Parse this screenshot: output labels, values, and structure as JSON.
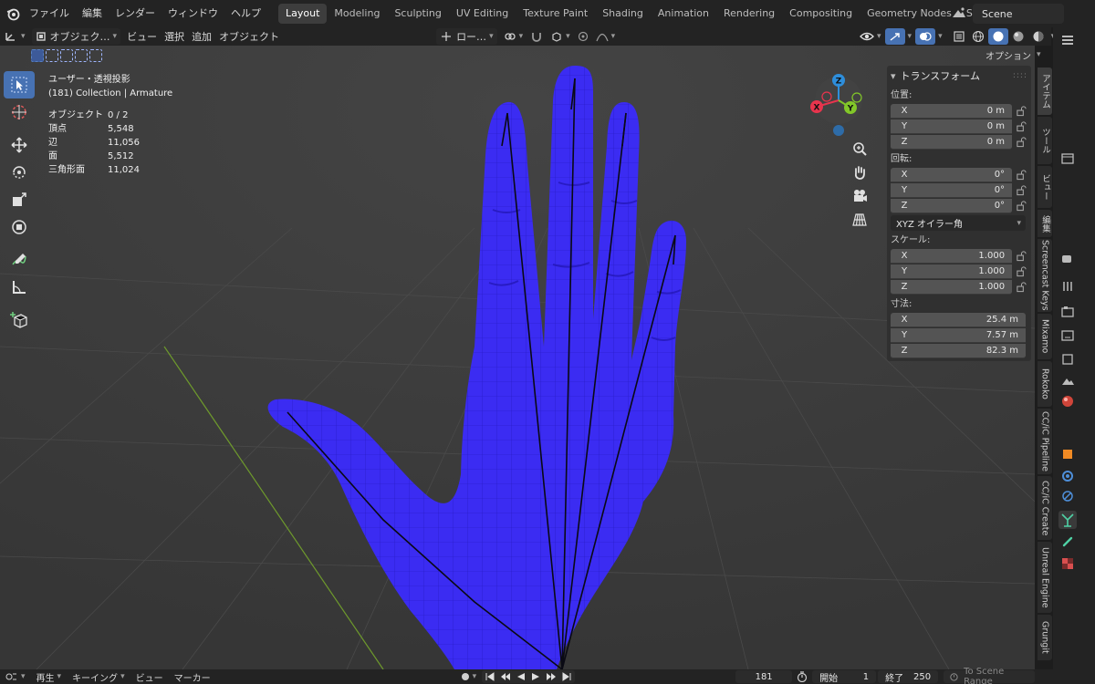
{
  "topbar": {
    "menus": [
      "ファイル",
      "編集",
      "レンダー",
      "ウィンドウ",
      "ヘルプ"
    ],
    "workspace_tabs": [
      "Layout",
      "Modeling",
      "Sculpting",
      "UV Editing",
      "Texture Paint",
      "Shading",
      "Animation",
      "Rendering",
      "Compositing",
      "Geometry Nodes",
      "Scripting"
    ],
    "active_tab": "Layout",
    "add_tab": "+",
    "scene_name": "Scene"
  },
  "viewport_header": {
    "mode": "オブジェク…",
    "menus": [
      "ビュー",
      "選択",
      "追加",
      "オブジェクト"
    ],
    "orientation": "ロー…",
    "options": "オプション"
  },
  "viewport_info": {
    "view_name": "ユーザー・透視投影",
    "collection": "(181) Collection | Armature",
    "stats": [
      {
        "label": "オブジェクト",
        "value": "0 / 2"
      },
      {
        "label": "頂点",
        "value": "5,548"
      },
      {
        "label": "辺",
        "value": "11,056"
      },
      {
        "label": "面",
        "value": "5,512"
      },
      {
        "label": "三角形面",
        "value": "11,024"
      }
    ]
  },
  "gizmo": {
    "x": "X",
    "y": "Y",
    "z": "Z"
  },
  "transform_panel": {
    "title": "トランスフォーム",
    "location_label": "位置:",
    "location": [
      {
        "axis": "X",
        "value": "0 m"
      },
      {
        "axis": "Y",
        "value": "0 m"
      },
      {
        "axis": "Z",
        "value": "0 m"
      }
    ],
    "rotation_label": "回転:",
    "rotation": [
      {
        "axis": "X",
        "value": "0°"
      },
      {
        "axis": "Y",
        "value": "0°"
      },
      {
        "axis": "Z",
        "value": "0°"
      }
    ],
    "rotation_mode": "XYZ オイラー角",
    "scale_label": "スケール:",
    "scale": [
      {
        "axis": "X",
        "value": "1.000"
      },
      {
        "axis": "Y",
        "value": "1.000"
      },
      {
        "axis": "Z",
        "value": "1.000"
      }
    ],
    "dimensions_label": "寸法:",
    "dimensions": [
      {
        "axis": "X",
        "value": "25.4 m"
      },
      {
        "axis": "Y",
        "value": "7.57 m"
      },
      {
        "axis": "Z",
        "value": "82.3 m"
      }
    ]
  },
  "side_tabs": [
    "アイテム",
    "ツール",
    "ビュー",
    "編集",
    "Screencast Keys",
    "Mixamo",
    "Rokoko",
    "CC/iC Pipeline",
    "CC/iC Create",
    "Unreal Engine",
    "Grungit"
  ],
  "timeline": {
    "playback": "再生",
    "keying": "キーイング",
    "view": "ビュー",
    "marker": "マーカー",
    "current_frame": "181",
    "start_label": "開始",
    "start_value": "1",
    "end_label": "終了",
    "end_value": "250",
    "range_label": "To Scene Range"
  },
  "colors": {
    "mesh": "#3b2cf2",
    "accent": "#4772b3",
    "axis_x": "#e8344d",
    "axis_y": "#82c729",
    "axis_z": "#2e8edb"
  }
}
